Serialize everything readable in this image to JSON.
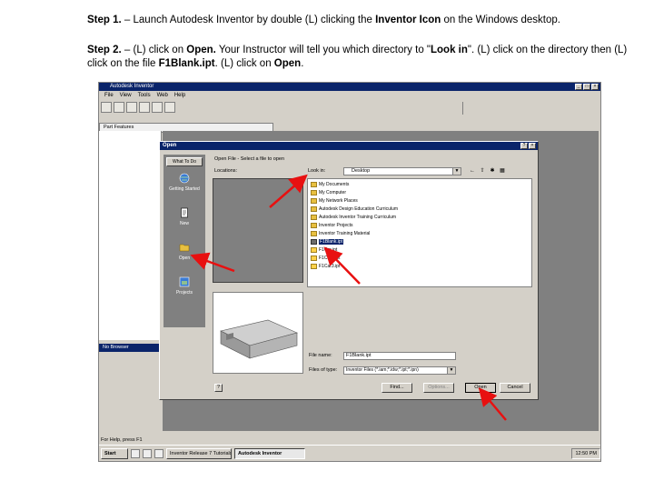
{
  "step1": {
    "label": "Step 1.",
    "text_a": " – Launch Autodesk Inventor by double (L) clicking the ",
    "bold_a": "Inventor Icon",
    "text_b": " on the Windows desktop."
  },
  "step2": {
    "label": "Step 2.",
    "text_a": " – (L) click on ",
    "bold_a": "Open.",
    "text_b": " Your Instructor will tell you which directory to \"",
    "bold_b": "Look in",
    "text_c": "\". (L) click on the directory then (L) click on the file ",
    "bold_c": "F1Blank.ipt",
    "text_d": ". (L) click on ",
    "bold_d": "Open",
    "text_e": "."
  },
  "app": {
    "title": "Autodesk Inventor",
    "menu": [
      "File",
      "View",
      "Tools",
      "Web",
      "Help"
    ],
    "panel_bar": "Part Features",
    "browser_bar": "No Browser",
    "status": "For Help, press F1"
  },
  "taskbar": {
    "start": "Start",
    "tasks": [
      "Inventor Release 7 Tutorials",
      "Autodesk Inventor"
    ],
    "time": "12:50 PM"
  },
  "dialog": {
    "title": "Open",
    "what_to_do": "What To Do",
    "places": [
      "Getting Started",
      "New",
      "Open",
      "Projects"
    ],
    "tab_header": "Open File - Select a file to open",
    "locations_label": "Locations:",
    "look_in_label": "Look in:",
    "look_in_value": "Desktop",
    "files": [
      {
        "name": "My Documents",
        "kind": "folder"
      },
      {
        "name": "My Computer",
        "kind": "folder"
      },
      {
        "name": "My Network Places",
        "kind": "folder"
      },
      {
        "name": "Autodesk Design Education Curriculum",
        "kind": "folder"
      },
      {
        "name": "Autodesk Inventor Training Curriculum",
        "kind": "folder"
      },
      {
        "name": "Inventor Projects",
        "kind": "folder"
      },
      {
        "name": "Inventor Training Material",
        "kind": "folder"
      },
      {
        "name": "F1Blank.ipt",
        "kind": "ipt",
        "selected": true
      },
      {
        "name": "F1Car.ipt",
        "kind": "doc"
      },
      {
        "name": "F1Car2.ipt",
        "kind": "doc"
      },
      {
        "name": "F1Car3.ipt",
        "kind": "doc"
      }
    ],
    "file_name_label": "File name:",
    "file_name_value": "F1Blank.ipt",
    "file_type_label": "Files of type:",
    "file_type_value": "Inventor Files (*.iam;*.idw;*.ipt;*.ipn)",
    "help": "?",
    "find": "Find...",
    "options": "Options...",
    "open": "Open",
    "cancel": "Cancel"
  },
  "colors": {
    "title_bar": "#0a246a",
    "window_face": "#d4d0c8",
    "arrow": "#e81010"
  }
}
